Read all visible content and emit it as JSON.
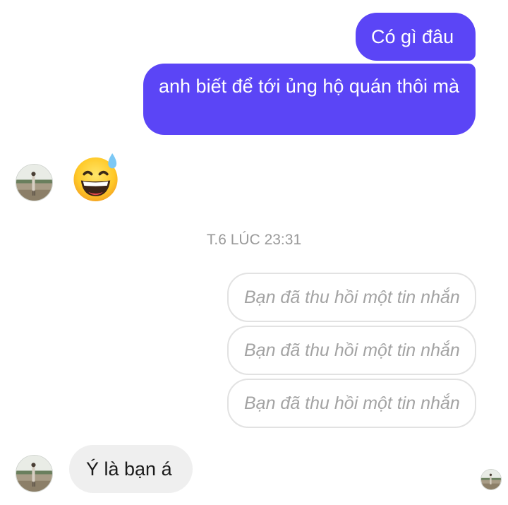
{
  "colors": {
    "sent_bubble": "#5b45f6",
    "sent_text": "#ffffff",
    "received_bubble": "#efefef",
    "recalled_border": "#e2e2e2",
    "recalled_text": "#a3a3a3",
    "timestamp_text": "#9a9a9a"
  },
  "conversation": {
    "sent_messages": [
      {
        "text": "Có gì đâu"
      },
      {
        "text": "anh biết để tới ủng hộ quán thôi mà"
      }
    ],
    "reaction_emoji": {
      "icon": "grinning-face-with-sweat-icon"
    },
    "timestamp": "T.6 LÚC 23:31",
    "recalled_messages": [
      {
        "text": "Bạn đã thu hồi một tin nhắn"
      },
      {
        "text": "Bạn đã thu hồi một tin nhắn"
      },
      {
        "text": "Bạn đã thu hồi một tin nhắn"
      }
    ],
    "received_messages": [
      {
        "text": "Ý là bạn á"
      }
    ],
    "contact_avatar": {
      "icon": "contact-avatar-photo"
    },
    "seen_indicator": {
      "icon": "seen-avatar-photo"
    }
  }
}
